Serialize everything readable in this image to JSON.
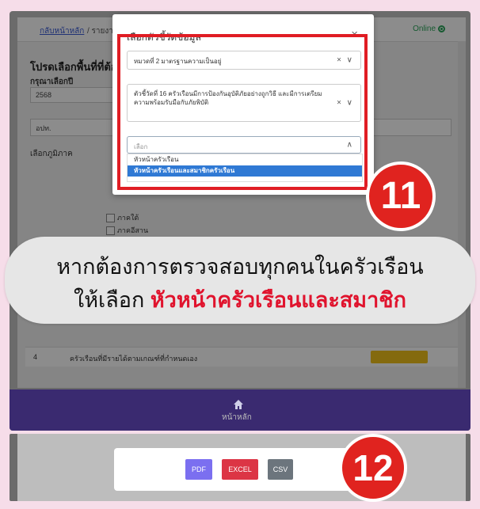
{
  "background": {
    "breadcrumb_home": "กลับหน้าหลัก",
    "breadcrumb_sep": "/ รายงาน",
    "online_label": "Online",
    "page_title": "โปรดเลือกพื้นที่ที่ต้อง",
    "year_label": "กรุณาเลือกปี",
    "year_value": "2568",
    "area_value": "อปท.",
    "region_label": "เลือกภูมิภาค",
    "region_south": "ภาคใต้",
    "region_northeast": "ภาคอีสาน",
    "table_row_no": "4",
    "table_row_text": "ครัวเรือนที่มีรายได้ตามเกณฑ์ที่กำหนดเอง",
    "footer_home_label": "หน้าหลัก"
  },
  "modal": {
    "title": "เลือกตัวชี้วัดข้อมูล",
    "close_glyph": "×",
    "select1_value": "หมวดที่ 2 มาตรฐานความเป็นอยู่",
    "select2_value": "ตัวชี้วัดที่ 16 ครัวเรือนมีการป้องกันอุบัติภัยอย่างถูกวิธี และมีการเตรียมความพร้อมรับมือกับภัยพิบัติ",
    "select3_placeholder": "เลือก",
    "control_glyph": "× ∨",
    "dropdown_caret": "∧",
    "options": [
      "หัวหน้าครัวเรือน",
      "หัวหน้าครัวเรือนและสมาชิกครัวเรือน"
    ]
  },
  "steps": {
    "step1": "11",
    "step2": "12"
  },
  "callout": {
    "line1": "หากต้องการตรวจสอบทุกคนในครัวเรือน",
    "line2_prefix": "ให้เลือก ",
    "line2_highlight": "หัวหน้าครัวเรือนและสมาชิก"
  },
  "export": {
    "pdf": "PDF",
    "excel": "EXCEL",
    "csv": "CSV"
  },
  "colors": {
    "highlight_red": "#e0132d",
    "selected_blue": "#2f79d4",
    "pdf": "#7b6ff0",
    "excel": "#dc3545",
    "csv": "#6c757d"
  }
}
